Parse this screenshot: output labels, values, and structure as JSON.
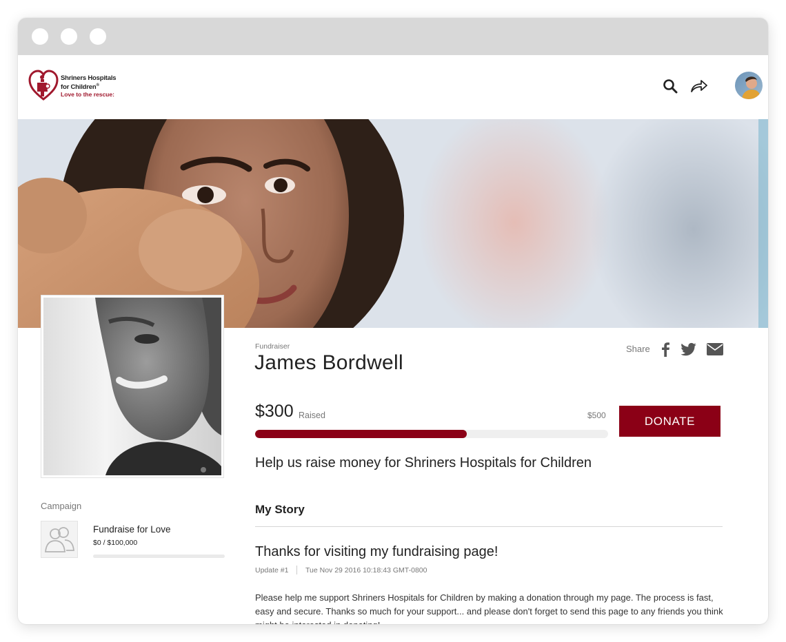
{
  "brand": {
    "name_line1": "Shriners Hospitals",
    "name_line2": "for Children",
    "trademark": "®",
    "tagline": "Love to the rescue:",
    "color": "#a0182d"
  },
  "nav": {
    "icons": [
      "search-icon",
      "share-forward-icon"
    ],
    "avatar": "user-avatar"
  },
  "fundraiser": {
    "role": "Fundraiser",
    "name": "James Bordwell",
    "headline": "Help us raise money for Shriners Hospitals for Children"
  },
  "share": {
    "label": "Share",
    "icons": [
      "facebook-icon",
      "twitter-icon",
      "mail-icon"
    ]
  },
  "progress": {
    "raised": "$300",
    "raised_label": "Raised",
    "goal": "$500",
    "fraction": 0.6,
    "accent": "#8b0016"
  },
  "donate_label": "DONATE",
  "campaign": {
    "label": "Campaign",
    "name": "Fundraise for Love",
    "amount": "$0 / $100,000",
    "fraction": 0
  },
  "story": {
    "title": "My Story",
    "update_title": "Thanks for visiting my fundraising page!",
    "update_number": "Update #1",
    "update_date": "Tue Nov 29 2016 10:18:43 GMT-0800",
    "body": "Please help me support Shriners Hospitals for Children by making a donation through my page. The process is fast, easy and secure. Thanks so much for your support... and please don't forget to send this page to any friends you think might be interested in donating!"
  }
}
